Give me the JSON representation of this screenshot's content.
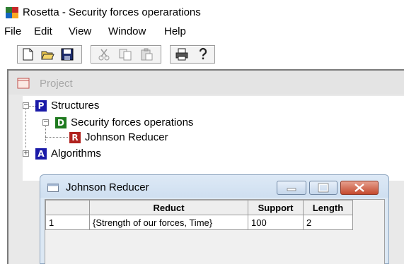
{
  "window": {
    "title": "Rosetta - Security forces operarations"
  },
  "menu": {
    "items": [
      "File",
      "Edit",
      "View",
      "Window",
      "Help"
    ]
  },
  "toolbar": {
    "buttons": [
      "new-file-icon",
      "open-folder-icon",
      "save-icon",
      "cut-icon",
      "copy-icon",
      "paste-icon",
      "print-icon",
      "help-icon"
    ]
  },
  "project": {
    "label": "Project",
    "tree": {
      "structures": {
        "badge": "P",
        "label": "Structures",
        "color": "#1a1aa8"
      },
      "operations": {
        "badge": "D",
        "label": "Security forces operations",
        "color": "#1f7a1f"
      },
      "reducer": {
        "badge": "R",
        "label": "Johnson Reducer",
        "color": "#b0221e"
      },
      "algorithms": {
        "badge": "A",
        "label": "Algorithms",
        "color": "#1a1aa8"
      }
    }
  },
  "child_window": {
    "title": "Johnson Reducer",
    "columns": [
      "",
      "Reduct",
      "Support",
      "Length"
    ],
    "rows": [
      {
        "index": "1",
        "reduct": "{Strength of our forces, Time}",
        "support": "100",
        "length": "2"
      }
    ]
  }
}
